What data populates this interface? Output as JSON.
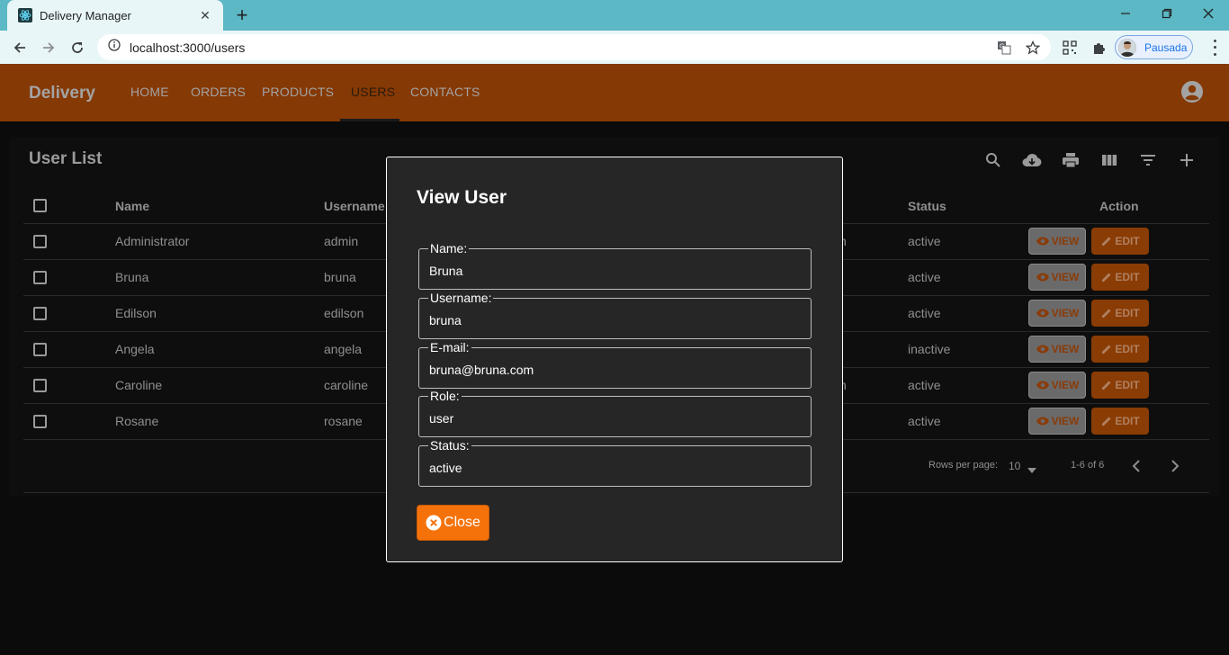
{
  "browser": {
    "tab_title": "Delivery Manager",
    "url": "localhost:3000/users",
    "profile_label": "Pausada",
    "icons": [
      "react-favicon-icon",
      "close-tab-icon",
      "new-tab-icon",
      "back-icon",
      "forward-icon",
      "reload-icon",
      "site-info-icon",
      "translate-icon",
      "bookmark-star-icon",
      "qr-code-icon",
      "extensions-icon",
      "profile-avatar",
      "menu-dots-icon",
      "minimize-icon",
      "restore-icon",
      "close-window-icon"
    ]
  },
  "app": {
    "brand": "Delivery",
    "nav": [
      "HOME",
      "ORDERS",
      "PRODUCTS",
      "USERS",
      "CONTACTS"
    ],
    "active_nav": "USERS",
    "colors": {
      "header": "#853904",
      "accent": "#f5720a",
      "background": "#0b0b0b"
    }
  },
  "page": {
    "title": "User List",
    "toolbar_icons": [
      "search-icon",
      "download-icon",
      "print-icon",
      "columns-icon",
      "filter-icon",
      "add-icon"
    ]
  },
  "table": {
    "headers": {
      "name": "Name",
      "username": "Username",
      "status": "Status",
      "action": "Action"
    },
    "rows": [
      {
        "name": "Administrator",
        "username": "admin",
        "status": "active",
        "trailing": "n"
      },
      {
        "name": "Bruna",
        "username": "bruna",
        "status": "active",
        "trailing": ""
      },
      {
        "name": "Edilson",
        "username": "edilson",
        "status": "active",
        "trailing": ""
      },
      {
        "name": "Angela",
        "username": "angela",
        "status": "inactive",
        "trailing": ""
      },
      {
        "name": "Caroline",
        "username": "caroline",
        "status": "active",
        "trailing": "n"
      },
      {
        "name": "Rosane",
        "username": "rosane",
        "status": "active",
        "trailing": ""
      }
    ],
    "view_label": "VIEW",
    "edit_label": "EDIT",
    "rows_per_page_label": "Rows per page:",
    "rows_per_page_value": "10",
    "pagination_text": "1-6 of 6"
  },
  "modal": {
    "title": "View User",
    "fields": [
      {
        "label": "Name:",
        "value": "Bruna"
      },
      {
        "label": "Username:",
        "value": "bruna"
      },
      {
        "label": "E-mail:",
        "value": "bruna@bruna.com"
      },
      {
        "label": "Role:",
        "value": "user"
      },
      {
        "label": "Status:",
        "value": "active"
      }
    ],
    "close_label": "Close"
  }
}
